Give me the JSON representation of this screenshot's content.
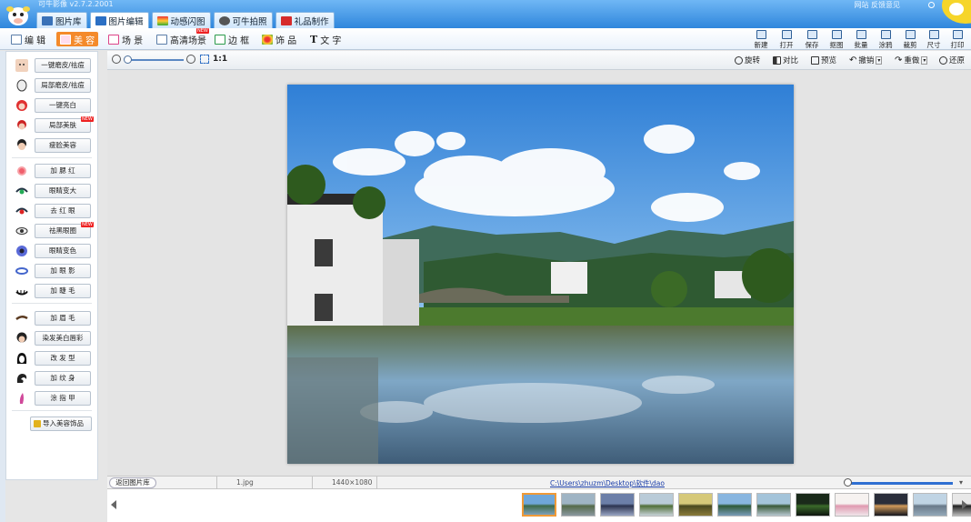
{
  "app": {
    "title": "可牛影像  v2.7.2.2001",
    "top_links": "网站  反馈意见",
    "colors": {
      "titlebar": "#2f86dc",
      "accent": "#f48a2a",
      "link": "#1a3da8"
    }
  },
  "main_tabs": [
    {
      "label": "图片库",
      "icon": "gallery-icon"
    },
    {
      "label": "图片编辑",
      "icon": "edit-picture-icon"
    },
    {
      "label": "动感闪图",
      "icon": "flash-image-icon"
    },
    {
      "label": "可牛拍照",
      "icon": "camera-icon"
    },
    {
      "label": "礼品制作",
      "icon": "gift-icon"
    }
  ],
  "edit_tools": [
    {
      "label": "编 辑",
      "icon": "edit-icon"
    },
    {
      "label": "美 容",
      "icon": "beauty-icon"
    },
    {
      "label": "场 景",
      "icon": "scene-icon"
    },
    {
      "label": "高清场景",
      "icon": "hd-scene-icon",
      "badge": "NEW"
    },
    {
      "label": "边 框",
      "icon": "frame-icon"
    },
    {
      "label": "饰 品",
      "icon": "decoration-icon"
    },
    {
      "label": "文 字",
      "icon": "text-icon"
    }
  ],
  "right_tools": [
    {
      "label": "新建",
      "icon": "new-file-icon"
    },
    {
      "label": "打开",
      "icon": "open-folder-icon"
    },
    {
      "label": "保存",
      "icon": "save-icon"
    },
    {
      "label": "抠图",
      "icon": "cutout-icon"
    },
    {
      "label": "批量",
      "icon": "batch-icon"
    },
    {
      "label": "涂鸦",
      "icon": "doodle-icon"
    },
    {
      "label": "裁剪",
      "icon": "crop-icon"
    },
    {
      "label": "尺寸",
      "icon": "resize-icon"
    },
    {
      "label": "打印",
      "icon": "print-icon"
    }
  ],
  "beauty_tools": [
    {
      "label": "一键磨皮/祛痘",
      "icon": "skin-smooth-icon"
    },
    {
      "label": "局部磨皮/祛痘",
      "icon": "partial-smooth-icon"
    },
    {
      "label": "一键亮白",
      "icon": "whitening-icon"
    },
    {
      "label": "局部美肤",
      "icon": "partial-skin-icon",
      "badge": "NEW"
    },
    {
      "label": "瘦脸美容",
      "icon": "slim-face-icon"
    },
    {
      "label": "加 腮 红",
      "icon": "blush-icon"
    },
    {
      "label": "眼睛变大",
      "icon": "eye-enlarge-icon"
    },
    {
      "label": "去 红 眼",
      "icon": "red-eye-icon"
    },
    {
      "label": "祛黑眼圈",
      "icon": "dark-circle-icon",
      "badge": "NEW"
    },
    {
      "label": "眼睛变色",
      "icon": "eye-color-icon"
    },
    {
      "label": "加 眼 影",
      "icon": "eye-shadow-icon"
    },
    {
      "label": "加 睫 毛",
      "icon": "eyelash-icon"
    },
    {
      "label": "加 眉 毛",
      "icon": "eyebrow-icon"
    },
    {
      "label": "染发美白唇彩",
      "icon": "hair-dye-icon"
    },
    {
      "label": "改 发 型",
      "icon": "hairstyle-icon"
    },
    {
      "label": "加 纹 身",
      "icon": "tattoo-icon"
    },
    {
      "label": "涂 指 甲",
      "icon": "nail-polish-icon"
    }
  ],
  "import_button": "导入美容饰品",
  "canvas_toolbar": {
    "zoom_label": "1:1",
    "actions": [
      "旋转",
      "对比",
      "预览",
      "撤销",
      "重做",
      "还原"
    ]
  },
  "status": {
    "back_button": "返回图片库",
    "filename": "1.jpg",
    "dimensions": "1440×1080",
    "path": "C:\\Users\\zhuzm\\Desktop\\软件\\dao"
  },
  "filmstrip": {
    "thumbnail_count": 13,
    "selected_index": 0
  }
}
